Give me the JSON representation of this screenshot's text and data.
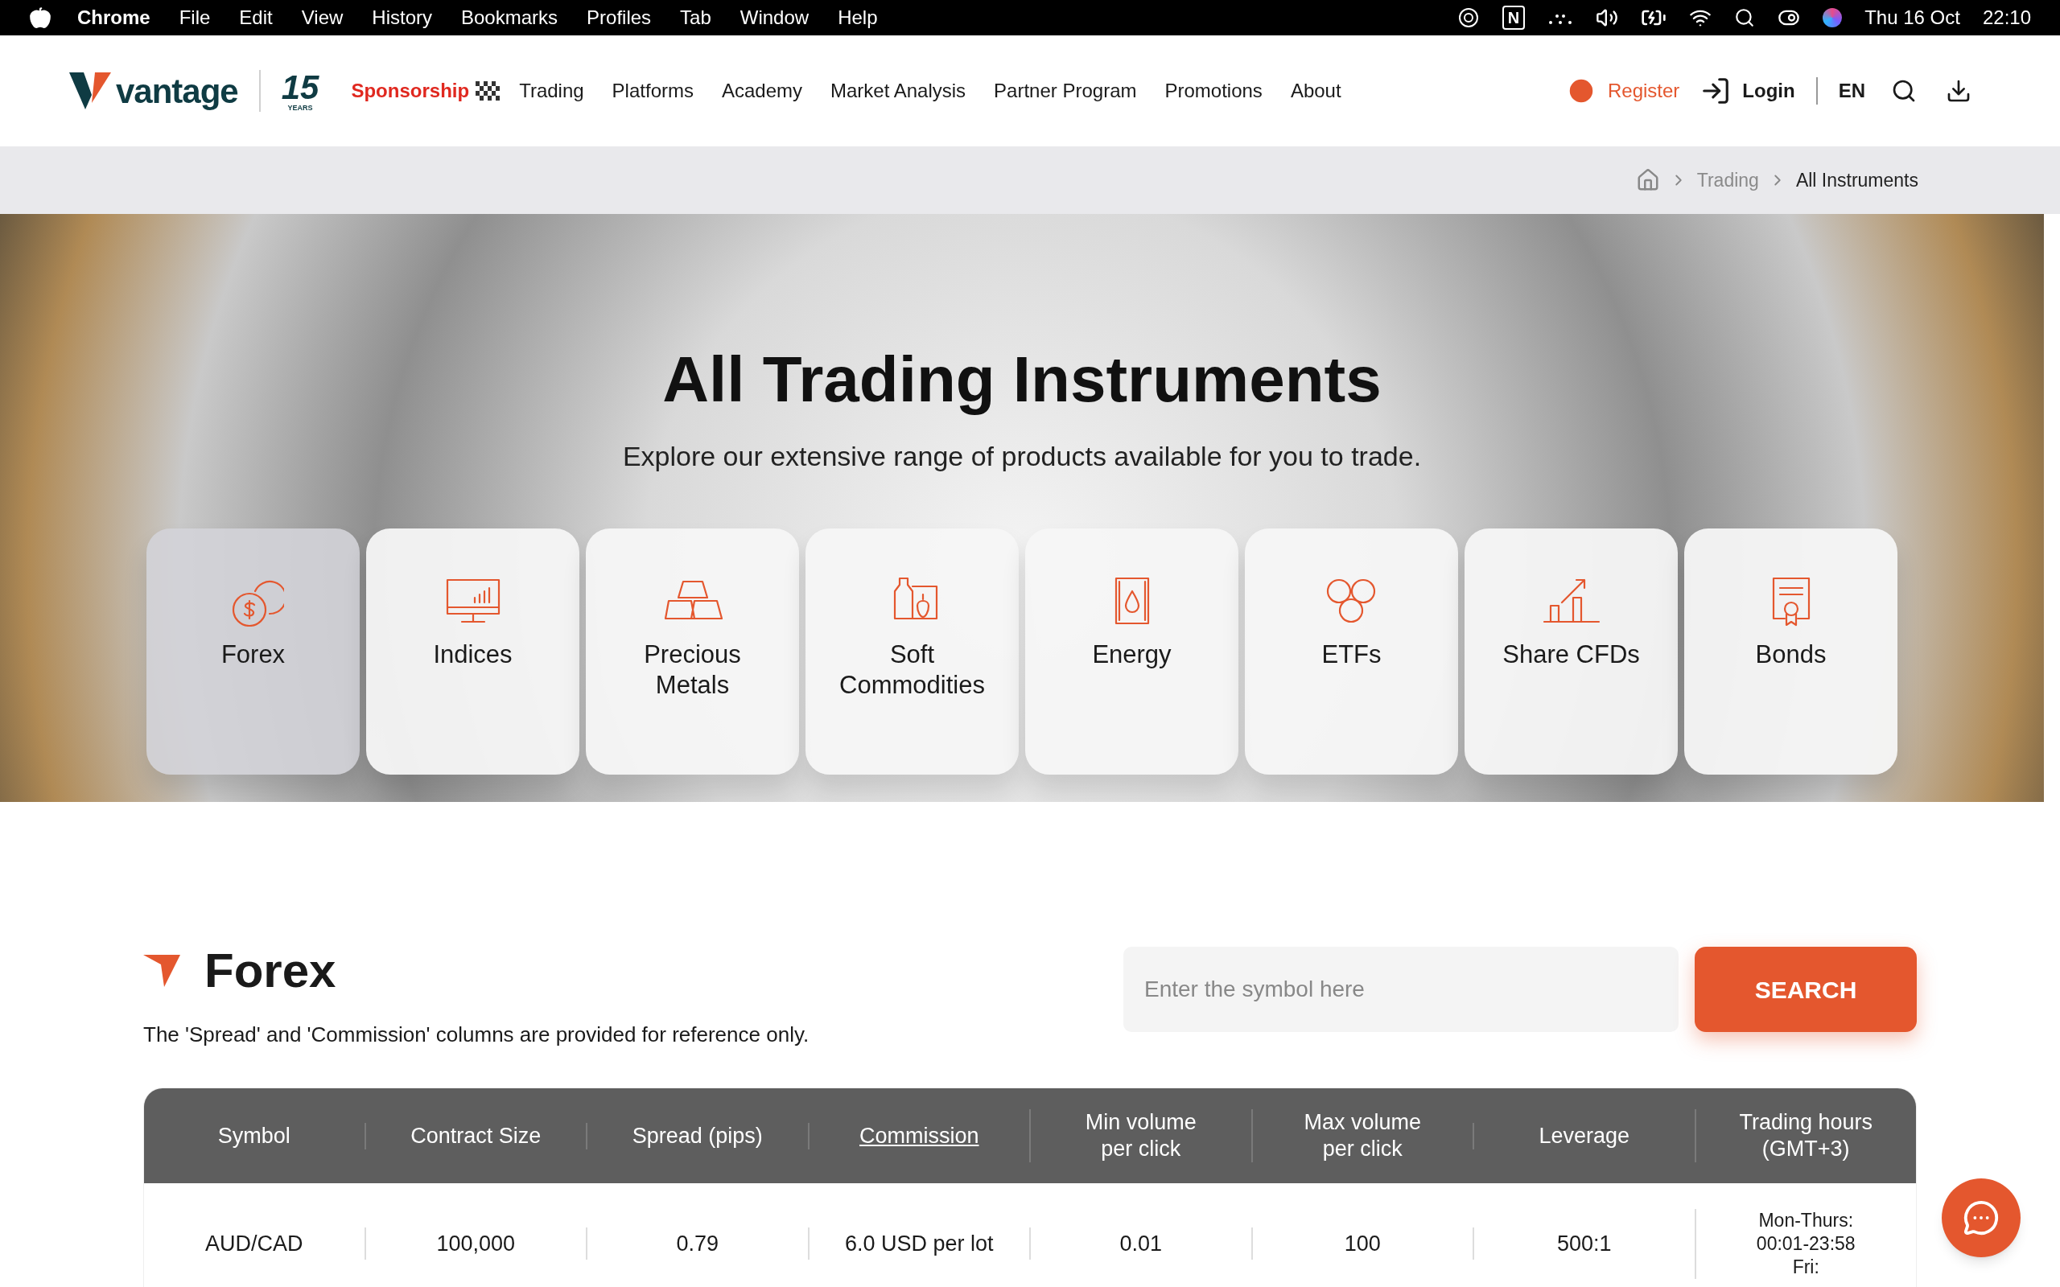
{
  "menu_bar": {
    "app": "Chrome",
    "menus": [
      "File",
      "Edit",
      "View",
      "History",
      "Bookmarks",
      "Profiles",
      "Tab",
      "Window",
      "Help"
    ],
    "notion_key": "N",
    "date": "Thu 16 Oct",
    "time": "22:10"
  },
  "header": {
    "logo": "vantage",
    "anniversary": {
      "number": "15",
      "caption": "YEARS"
    },
    "sponsorship": "Sponsorship",
    "nav": [
      "Trading",
      "Platforms",
      "Academy",
      "Market Analysis",
      "Partner Program",
      "Promotions",
      "About"
    ],
    "register": "Register",
    "login": "Login",
    "language": "EN"
  },
  "breadcrumb": [
    "Trading",
    "All Instruments"
  ],
  "hero": {
    "title": "All Trading Instruments",
    "subtitle": "Explore our extensive range of products available for you to trade."
  },
  "categories": [
    {
      "label": "Forex",
      "selected": true
    },
    {
      "label": "Indices",
      "selected": false
    },
    {
      "label": "Precious Metals",
      "selected": false
    },
    {
      "label": "Soft Commodities",
      "selected": false
    },
    {
      "label": "Energy",
      "selected": false
    },
    {
      "label": "ETFs",
      "selected": false
    },
    {
      "label": "Share CFDs",
      "selected": false
    },
    {
      "label": "Bonds",
      "selected": false
    }
  ],
  "section": {
    "title": "Forex",
    "note": "The 'Spread' and 'Commission' columns are provided for reference only.",
    "search": {
      "placeholder": "Enter the symbol here",
      "button": "SEARCH"
    }
  },
  "table": {
    "columns": [
      {
        "label": "Symbol",
        "kind": "text"
      },
      {
        "label": "Contract Size",
        "kind": "text"
      },
      {
        "label": "Spread (pips)",
        "kind": "text"
      },
      {
        "label": "Commission",
        "kind": "link"
      },
      {
        "label": "Min volume per click",
        "kind": "text"
      },
      {
        "label": "Max volume per click",
        "kind": "text"
      },
      {
        "label": "Leverage",
        "kind": "text"
      },
      {
        "label": "Trading hours (GMT+3)",
        "kind": "text"
      }
    ],
    "rows": [
      {
        "cells": [
          "AUD/CAD",
          "100,000",
          "0.79",
          "6.0 USD per lot",
          "0.01",
          "100",
          "500:1"
        ],
        "trading_hours": [
          "Mon-Thurs:",
          "00:01-23:58",
          "Fri:"
        ]
      }
    ]
  }
}
